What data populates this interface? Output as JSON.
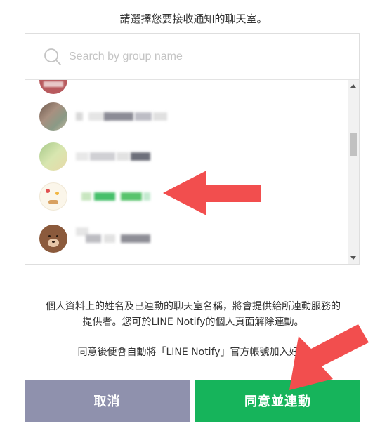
{
  "header": {
    "text": "請選擇您要接收通知的聊天室。"
  },
  "search": {
    "placeholder": "Search by group name",
    "value": "",
    "icon": "search-icon"
  },
  "chat_list": {
    "items": [
      {
        "avatar": "avatar-partial",
        "name": ""
      },
      {
        "avatar": "avatar-photo",
        "name": ""
      },
      {
        "avatar": "avatar-green",
        "name": ""
      },
      {
        "avatar": "avatar-sticker",
        "name": ""
      },
      {
        "avatar": "avatar-brown-bear",
        "name": ""
      }
    ]
  },
  "disclaimer": {
    "line1": "個人資料上的姓名及已連動的聊天室名稱，將會提供給所連動服務的",
    "line2": "提供者。您可於LINE Notify的個人頁面解除連動。"
  },
  "consent": {
    "text": "同意後便會自動將「LINE Notify」官方帳號加入好友"
  },
  "buttons": {
    "cancel": "取消",
    "agree": "同意並連動"
  },
  "colors": {
    "cancel_bg": "#8f91ad",
    "agree_bg": "#16b45b",
    "annotation_arrow": "#f24e4e"
  }
}
